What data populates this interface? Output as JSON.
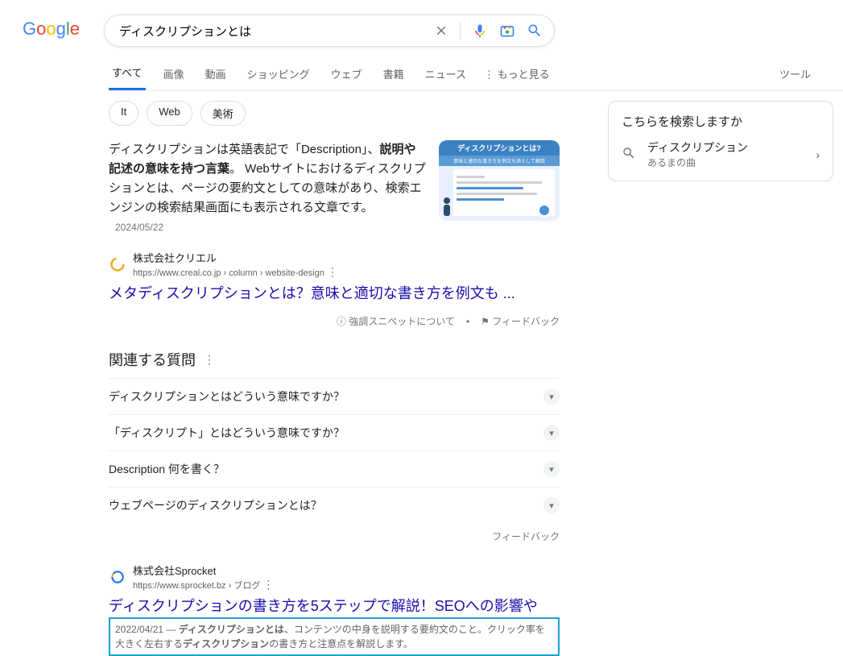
{
  "search": {
    "query": "ディスクリプションとは"
  },
  "logo": {
    "g1": "G",
    "o1": "o",
    "o2": "o",
    "g2": "g",
    "l": "l",
    "e": "e"
  },
  "tabs": [
    "すべて",
    "画像",
    "動画",
    "ショッピング",
    "ウェブ",
    "書籍",
    "ニュース"
  ],
  "more_label": "もっと見る",
  "tools_label": "ツール",
  "chips": [
    "It",
    "Web",
    "美術"
  ],
  "featured": {
    "text_pre": "ディスクリプションは英語表記で「Description」、",
    "text_bold": "説明や記述の意味を持つ言葉",
    "text_post": "。 Webサイトにおけるディスクリプションとは、ページの要約文としての意味があり、検索エンジンの検索結果画面にも表示される文章です。",
    "date": "2024/05/22",
    "img_title": "ディスクリプションとは?",
    "img_sub": "意味と適切な書き方を例文も添えして解説"
  },
  "result1": {
    "source": "株式会社クリエル",
    "url": "https://www.creal.co.jp › column › website-design",
    "title": "メタディスクリプションとは？意味と適切な書き方を例文も ..."
  },
  "snippet_footer": {
    "about": "強調スニペットについて",
    "feedback": "フィードバック"
  },
  "paa": {
    "heading": "関連する質問",
    "items": [
      "ディスクリプションとはどういう意味ですか？",
      "「ディスクリプト」とはどういう意味ですか？",
      "Description 何を書く？",
      "ウェブページのディスクリプションとは？"
    ],
    "feedback": "フィードバック"
  },
  "result2": {
    "source": "株式会社Sprocket",
    "url": "https://www.sprocket.bz › ブログ",
    "title": "ディスクリプションの書き方を5ステップで解説！SEOへの影響や",
    "date": "2022/04/21",
    "desc_pre": " — ",
    "desc_e1": "ディスクリプションとは",
    "desc_mid": "、コンテンツの中身を説明する要約文のこと。クリック率を大きく左右する",
    "desc_e2": "ディスクリプション",
    "desc_post": "の書き方と注意点を解説します。"
  },
  "side": {
    "title": "こちらを検索しますか",
    "main": "ディスクリプション",
    "sub": "あるまの曲"
  }
}
